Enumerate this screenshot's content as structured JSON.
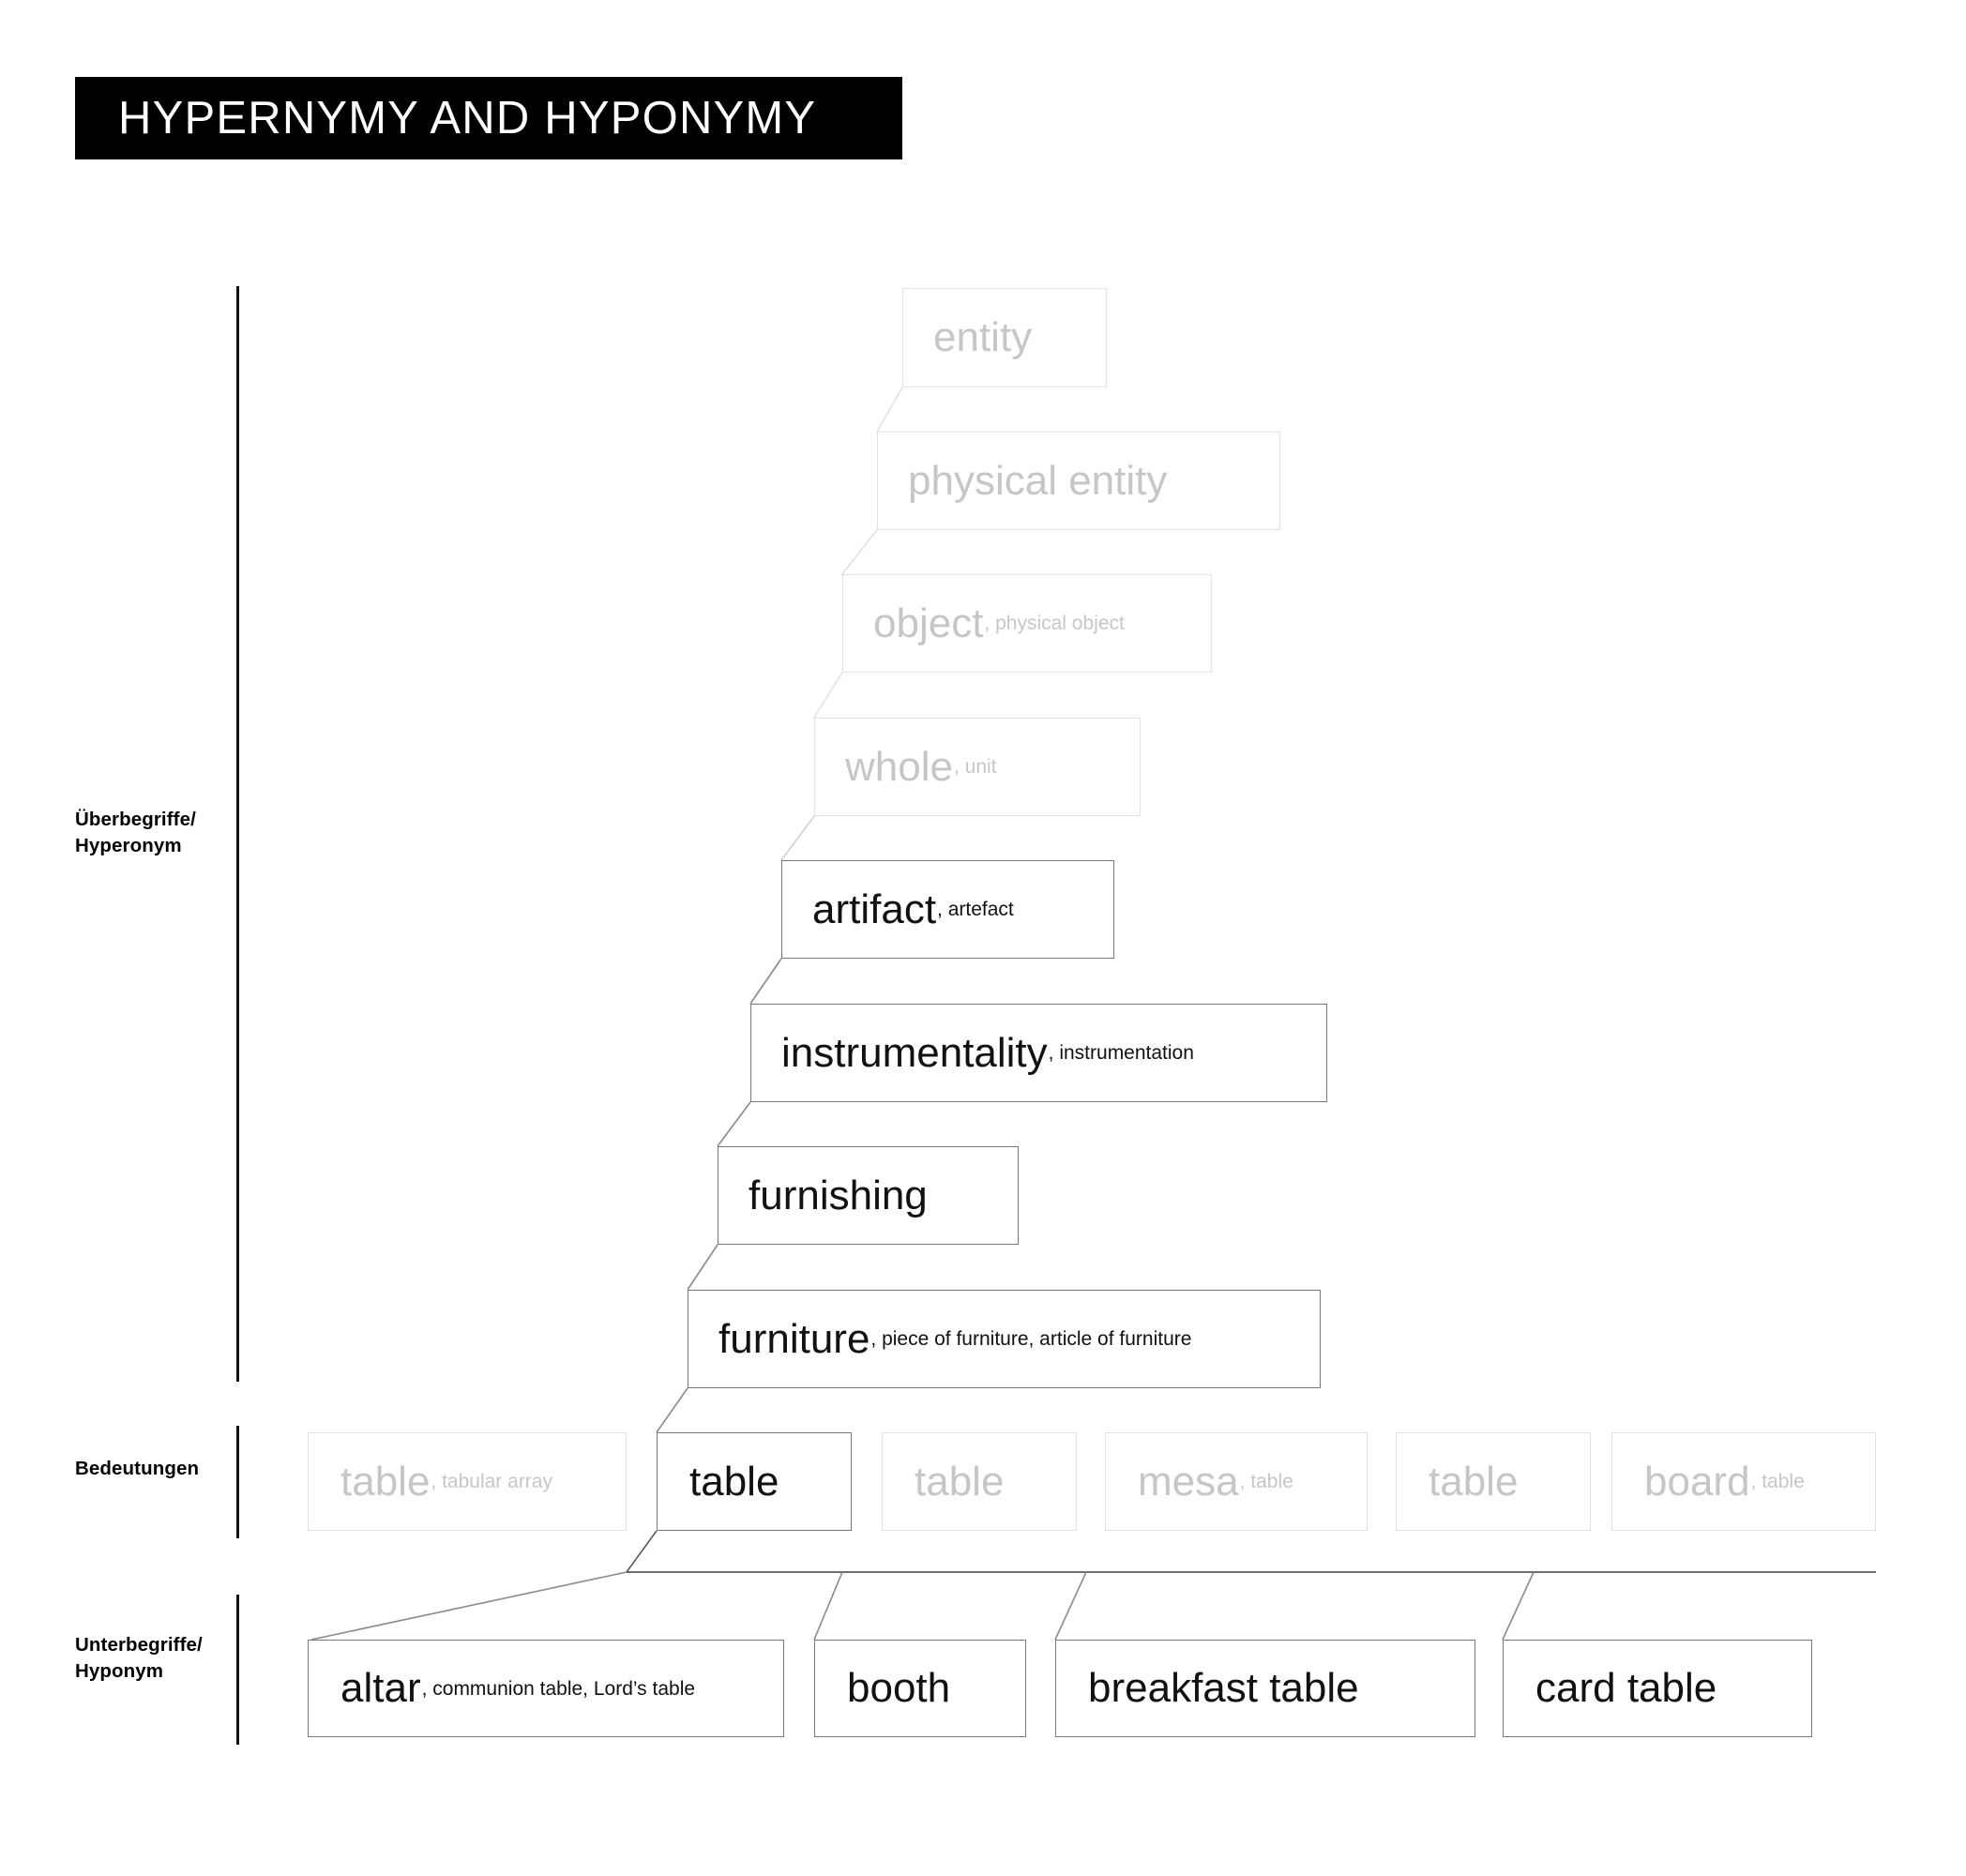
{
  "page": {
    "title": "HYPERNYMY AND HYPONYMY",
    "background_color": "#ffffff",
    "banner_color": "#000000",
    "banner_text_color": "#ffffff",
    "faded_color": "#c6c6c6",
    "strong_color": "#111111"
  },
  "rails": {
    "hypernym_label": "Überbegriffe/\nHyperonym",
    "senses_label": "Bedeutungen",
    "hyponym_label": "Unterbegriffe/\nHyponym"
  },
  "hypernym_chain": [
    {
      "term": "entity",
      "synonyms": "",
      "state": "faded"
    },
    {
      "term": "physical entity",
      "synonyms": "",
      "state": "faded"
    },
    {
      "term": "object",
      "synonyms": ", physical object",
      "state": "faded"
    },
    {
      "term": "whole",
      "synonyms": ", unit",
      "state": "faded"
    },
    {
      "term": "artifact",
      "synonyms": ", artefact",
      "state": "strong"
    },
    {
      "term": "instrumentality",
      "synonyms": ", instrumentation",
      "state": "strong"
    },
    {
      "term": "furnishing",
      "synonyms": "",
      "state": "strong"
    },
    {
      "term": "furniture",
      "synonyms": ", piece of furniture, article of furniture",
      "state": "strong"
    }
  ],
  "senses": [
    {
      "term": "table",
      "synonyms": ", tabular array",
      "state": "faded"
    },
    {
      "term": "table",
      "synonyms": "",
      "state": "strong"
    },
    {
      "term": "table",
      "synonyms": "",
      "state": "faded"
    },
    {
      "term": "mesa",
      "synonyms": ", table",
      "state": "faded"
    },
    {
      "term": "table",
      "synonyms": "",
      "state": "faded"
    },
    {
      "term": "board",
      "synonyms": ", table",
      "state": "faded"
    }
  ],
  "hyponyms": [
    {
      "term": "altar",
      "synonyms": ", communion table, Lord’s table",
      "state": "strong"
    },
    {
      "term": "booth",
      "synonyms": "",
      "state": "strong"
    },
    {
      "term": "breakfast table",
      "synonyms": "",
      "state": "strong"
    },
    {
      "term": "card table",
      "synonyms": "",
      "state": "strong"
    }
  ]
}
